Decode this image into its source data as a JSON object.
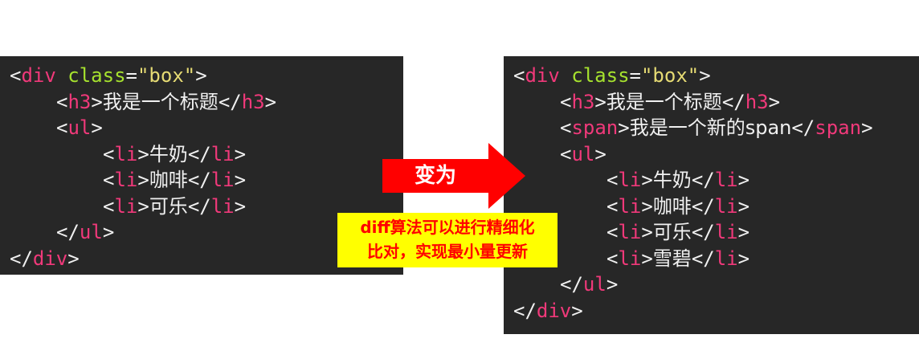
{
  "before_code": {
    "lines": [
      {
        "indent": 0,
        "tokens": [
          {
            "k": "punct",
            "t": "<"
          },
          {
            "k": "tag",
            "t": "div"
          },
          {
            "k": "punct",
            "t": " "
          },
          {
            "k": "attr",
            "t": "class"
          },
          {
            "k": "punct",
            "t": "="
          },
          {
            "k": "str",
            "t": "\"box\""
          },
          {
            "k": "punct",
            "t": ">"
          }
        ]
      },
      {
        "indent": 1,
        "tokens": [
          {
            "k": "punct",
            "t": "<"
          },
          {
            "k": "tag",
            "t": "h3"
          },
          {
            "k": "punct",
            "t": ">"
          },
          {
            "k": "text",
            "t": "我是一个标题"
          },
          {
            "k": "punct",
            "t": "</"
          },
          {
            "k": "tag",
            "t": "h3"
          },
          {
            "k": "punct",
            "t": ">"
          }
        ]
      },
      {
        "indent": 1,
        "tokens": [
          {
            "k": "punct",
            "t": "<"
          },
          {
            "k": "tag",
            "t": "ul"
          },
          {
            "k": "punct",
            "t": ">"
          }
        ]
      },
      {
        "indent": 2,
        "tokens": [
          {
            "k": "punct",
            "t": "<"
          },
          {
            "k": "tag",
            "t": "li"
          },
          {
            "k": "punct",
            "t": ">"
          },
          {
            "k": "text",
            "t": "牛奶"
          },
          {
            "k": "punct",
            "t": "</"
          },
          {
            "k": "tag",
            "t": "li"
          },
          {
            "k": "punct",
            "t": ">"
          }
        ]
      },
      {
        "indent": 2,
        "tokens": [
          {
            "k": "punct",
            "t": "<"
          },
          {
            "k": "tag",
            "t": "li"
          },
          {
            "k": "punct",
            "t": ">"
          },
          {
            "k": "text",
            "t": "咖啡"
          },
          {
            "k": "punct",
            "t": "</"
          },
          {
            "k": "tag",
            "t": "li"
          },
          {
            "k": "punct",
            "t": ">"
          }
        ]
      },
      {
        "indent": 2,
        "tokens": [
          {
            "k": "punct",
            "t": "<"
          },
          {
            "k": "tag",
            "t": "li"
          },
          {
            "k": "punct",
            "t": ">"
          },
          {
            "k": "text",
            "t": "可乐"
          },
          {
            "k": "punct",
            "t": "</"
          },
          {
            "k": "tag",
            "t": "li"
          },
          {
            "k": "punct",
            "t": ">"
          }
        ]
      },
      {
        "indent": 1,
        "tokens": [
          {
            "k": "punct",
            "t": "</"
          },
          {
            "k": "tag",
            "t": "ul"
          },
          {
            "k": "punct",
            "t": ">"
          }
        ]
      },
      {
        "indent": 0,
        "tokens": [
          {
            "k": "punct",
            "t": "</"
          },
          {
            "k": "tag",
            "t": "div"
          },
          {
            "k": "punct",
            "t": ">"
          }
        ]
      }
    ]
  },
  "after_code": {
    "lines": [
      {
        "indent": 0,
        "tokens": [
          {
            "k": "punct",
            "t": "<"
          },
          {
            "k": "tag",
            "t": "div"
          },
          {
            "k": "punct",
            "t": " "
          },
          {
            "k": "attr",
            "t": "class"
          },
          {
            "k": "punct",
            "t": "="
          },
          {
            "k": "str",
            "t": "\"box\""
          },
          {
            "k": "punct",
            "t": ">"
          }
        ]
      },
      {
        "indent": 1,
        "tokens": [
          {
            "k": "punct",
            "t": "<"
          },
          {
            "k": "tag",
            "t": "h3"
          },
          {
            "k": "punct",
            "t": ">"
          },
          {
            "k": "text",
            "t": "我是一个标题"
          },
          {
            "k": "punct",
            "t": "</"
          },
          {
            "k": "tag",
            "t": "h3"
          },
          {
            "k": "punct",
            "t": ">"
          }
        ]
      },
      {
        "indent": 1,
        "tokens": [
          {
            "k": "punct",
            "t": "<"
          },
          {
            "k": "tag",
            "t": "span"
          },
          {
            "k": "punct",
            "t": ">"
          },
          {
            "k": "text",
            "t": "我是一个新的span"
          },
          {
            "k": "punct",
            "t": "</"
          },
          {
            "k": "tag",
            "t": "span"
          },
          {
            "k": "punct",
            "t": ">"
          }
        ]
      },
      {
        "indent": 1,
        "tokens": [
          {
            "k": "punct",
            "t": "<"
          },
          {
            "k": "tag",
            "t": "ul"
          },
          {
            "k": "punct",
            "t": ">"
          }
        ]
      },
      {
        "indent": 2,
        "tokens": [
          {
            "k": "punct",
            "t": "<"
          },
          {
            "k": "tag",
            "t": "li"
          },
          {
            "k": "punct",
            "t": ">"
          },
          {
            "k": "text",
            "t": "牛奶"
          },
          {
            "k": "punct",
            "t": "</"
          },
          {
            "k": "tag",
            "t": "li"
          },
          {
            "k": "punct",
            "t": ">"
          }
        ]
      },
      {
        "indent": 2,
        "tokens": [
          {
            "k": "punct",
            "t": "<"
          },
          {
            "k": "tag",
            "t": "li"
          },
          {
            "k": "punct",
            "t": ">"
          },
          {
            "k": "text",
            "t": "咖啡"
          },
          {
            "k": "punct",
            "t": "</"
          },
          {
            "k": "tag",
            "t": "li"
          },
          {
            "k": "punct",
            "t": ">"
          }
        ]
      },
      {
        "indent": 2,
        "tokens": [
          {
            "k": "punct",
            "t": "<"
          },
          {
            "k": "tag",
            "t": "li"
          },
          {
            "k": "punct",
            "t": ">"
          },
          {
            "k": "text",
            "t": "可乐"
          },
          {
            "k": "punct",
            "t": "</"
          },
          {
            "k": "tag",
            "t": "li"
          },
          {
            "k": "punct",
            "t": ">"
          }
        ]
      },
      {
        "indent": 2,
        "tokens": [
          {
            "k": "punct",
            "t": "<"
          },
          {
            "k": "tag",
            "t": "li"
          },
          {
            "k": "punct",
            "t": ">"
          },
          {
            "k": "text",
            "t": "雪碧"
          },
          {
            "k": "punct",
            "t": "</"
          },
          {
            "k": "tag",
            "t": "li"
          },
          {
            "k": "punct",
            "t": ">"
          }
        ]
      },
      {
        "indent": 1,
        "tokens": [
          {
            "k": "punct",
            "t": "</"
          },
          {
            "k": "tag",
            "t": "ul"
          },
          {
            "k": "punct",
            "t": ">"
          }
        ]
      },
      {
        "indent": 0,
        "tokens": [
          {
            "k": "punct",
            "t": "</"
          },
          {
            "k": "tag",
            "t": "div"
          },
          {
            "k": "punct",
            "t": ">"
          }
        ]
      }
    ]
  },
  "arrow": {
    "label": "变为",
    "color": "#ff0000"
  },
  "note": {
    "line1": "diff算法可以进行精细化",
    "line2": "比对，实现最小量更新",
    "text_color": "#ff0000",
    "background": "#ffff00"
  },
  "colors": {
    "panel_background": "#272727",
    "tag": "#f0397a",
    "attribute": "#a6e22e",
    "string": "#e6db74",
    "text": "#f0f0f0"
  }
}
